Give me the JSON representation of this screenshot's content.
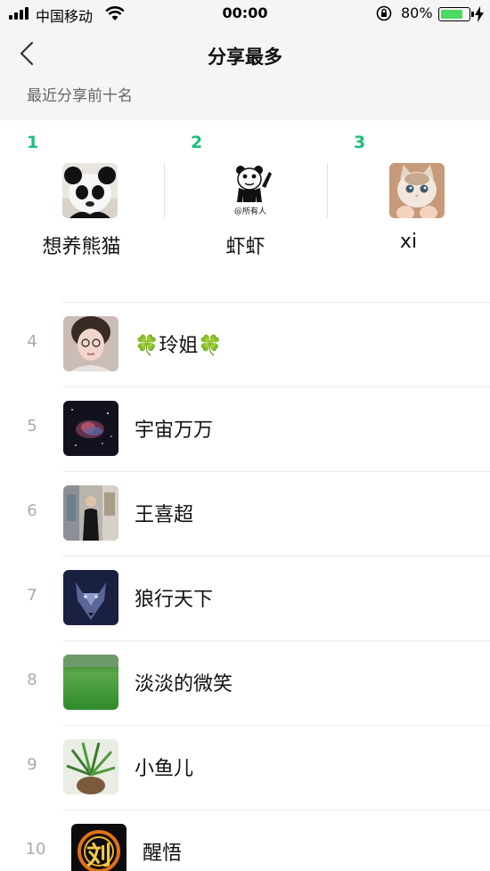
{
  "status_bar": {
    "carrier": "中国移动",
    "time": "00:00",
    "battery_percent": "80%",
    "battery_level": 0.8,
    "battery_color": "#4cd964"
  },
  "nav": {
    "back_icon": "chevron-left-icon",
    "title": "分享最多"
  },
  "section": {
    "title": "最近分享前十名"
  },
  "accent_color": "#1dbf7a",
  "top3": [
    {
      "rank": "1",
      "name": "想养熊猫",
      "avatar": "panda-avatar"
    },
    {
      "rank": "2",
      "name": "虾虾",
      "avatar": "panda-meme-avatar",
      "avatar_caption": "@所有人"
    },
    {
      "rank": "3",
      "name": "xi",
      "avatar": "cat-avatar"
    }
  ],
  "list": [
    {
      "rank": "4",
      "name": "🍀玲姐🍀",
      "avatar": "woman-selfie-avatar"
    },
    {
      "rank": "5",
      "name": "宇宙万万",
      "avatar": "nebula-avatar"
    },
    {
      "rank": "6",
      "name": "王喜超",
      "avatar": "man-in-store-avatar"
    },
    {
      "rank": "7",
      "name": "狼行天下",
      "avatar": "wolf-avatar"
    },
    {
      "rank": "8",
      "name": "淡淡的微笑",
      "avatar": "grass-field-avatar"
    },
    {
      "rank": "9",
      "name": "小鱼儿",
      "avatar": "potted-plant-avatar"
    },
    {
      "rank": "10",
      "name": "醒悟",
      "avatar": "fire-logo-avatar",
      "avatar_caption": "刘"
    }
  ]
}
